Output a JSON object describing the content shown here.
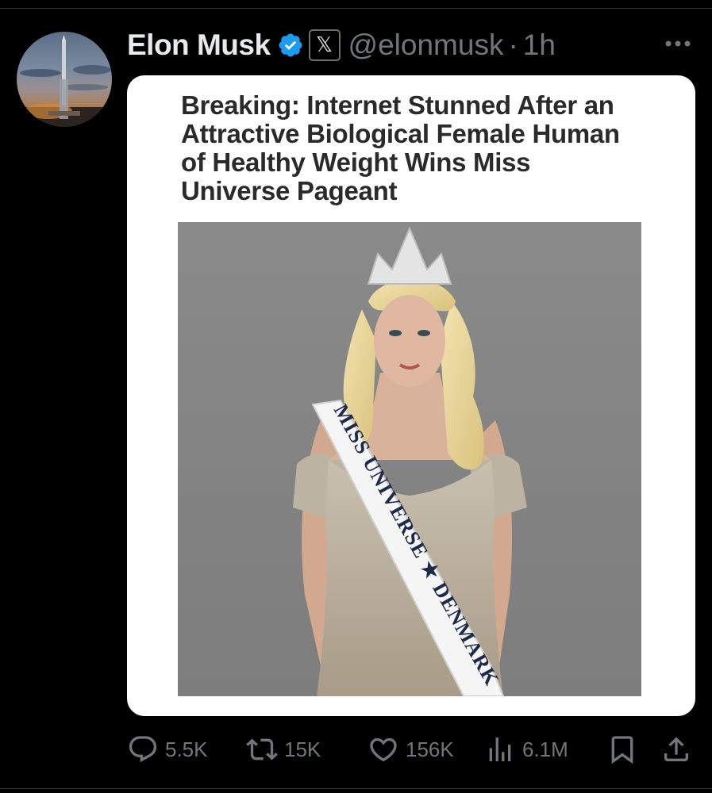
{
  "post": {
    "author": {
      "display_name": "Elon Musk",
      "handle": "@elonmusk",
      "verified": true,
      "affiliate_badge": "𝕏"
    },
    "separator": "·",
    "time": "1h",
    "more_icon": "more-horizontal-icon",
    "image": {
      "headline": "Breaking: Internet Stunned After an Attractive Biological Female Human of Healthy Weight Wins Miss Universe Pageant",
      "sash_text": "MISS UNIVERSE ★ DENMARK"
    },
    "actions": {
      "replies": "5.5K",
      "reposts": "15K",
      "likes": "156K",
      "views": "6.1M"
    }
  },
  "colors": {
    "background": "#000000",
    "text_primary": "#e7e9ea",
    "text_secondary": "#71767b",
    "verified_blue": "#1d9bf0",
    "card_background": "#ffffff"
  }
}
